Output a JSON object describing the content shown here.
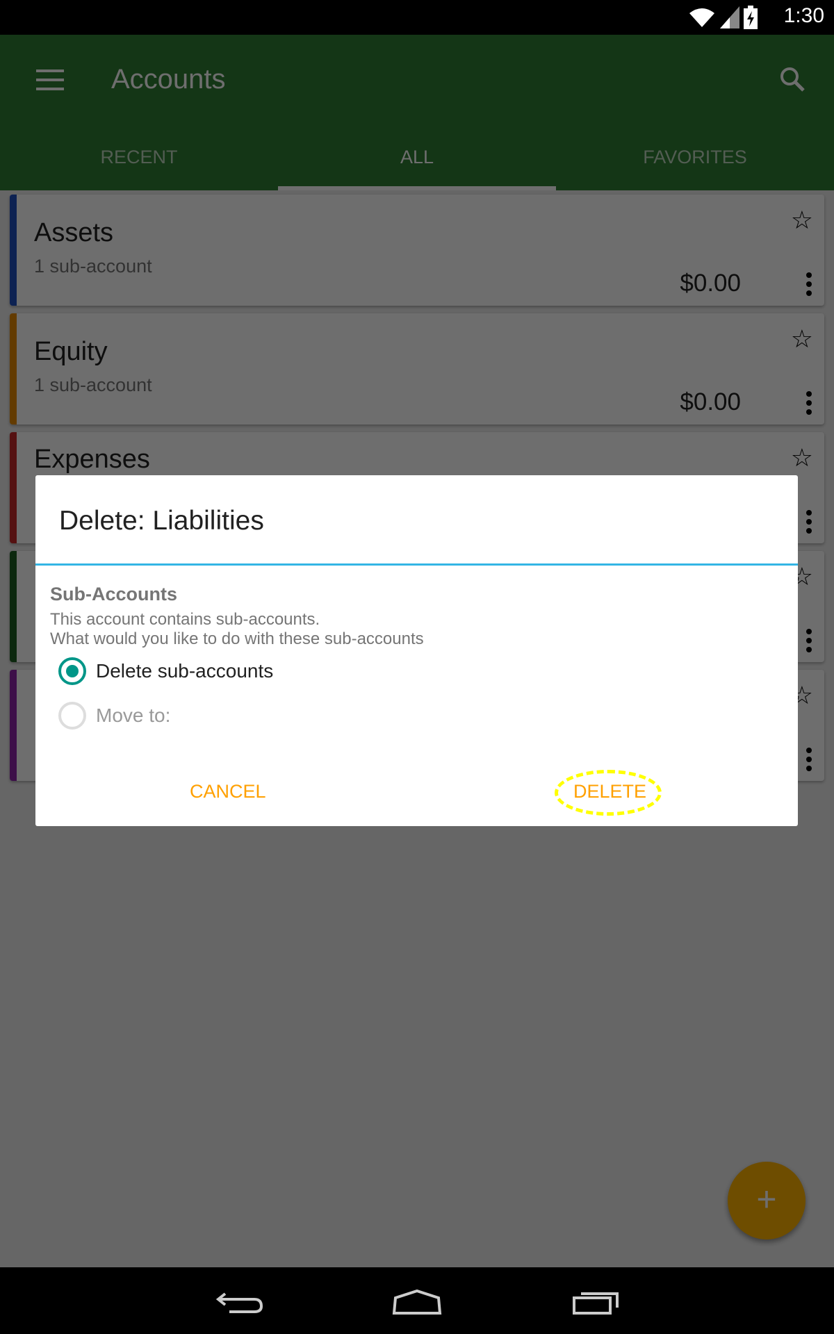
{
  "status_bar": {
    "time": "1:30",
    "icons": [
      "wifi-icon",
      "signal-icon",
      "battery-charging-icon"
    ]
  },
  "toolbar": {
    "title": "Accounts",
    "menu_icon": "menu-icon",
    "search_icon": "search-icon"
  },
  "tabs": [
    {
      "label": "RECENT"
    },
    {
      "label": "ALL",
      "active": true
    },
    {
      "label": "FAVORITES"
    }
  ],
  "accounts": [
    {
      "name": "Assets",
      "sub": "1 sub-account",
      "balance": "$0.00",
      "color": "#1e4fbf"
    },
    {
      "name": "Equity",
      "sub": "1 sub-account",
      "balance": "$0.00",
      "color": "#e68a00"
    },
    {
      "name": "Expenses",
      "color": "#c62828"
    },
    {
      "color": "#1b5e20"
    },
    {
      "color": "#8e24aa"
    }
  ],
  "dialog": {
    "title": "Delete: Liabilities",
    "section": "Sub-Accounts",
    "message_1": "This account contains sub-accounts.",
    "message_2": "What would you like to do with these sub-accounts",
    "options": [
      {
        "label": "Delete sub-accounts",
        "selected": true
      },
      {
        "label": "Move to:",
        "selected": false
      }
    ],
    "cancel": "CANCEL",
    "delete": "DELETE"
  },
  "fab": {
    "label": "+"
  }
}
